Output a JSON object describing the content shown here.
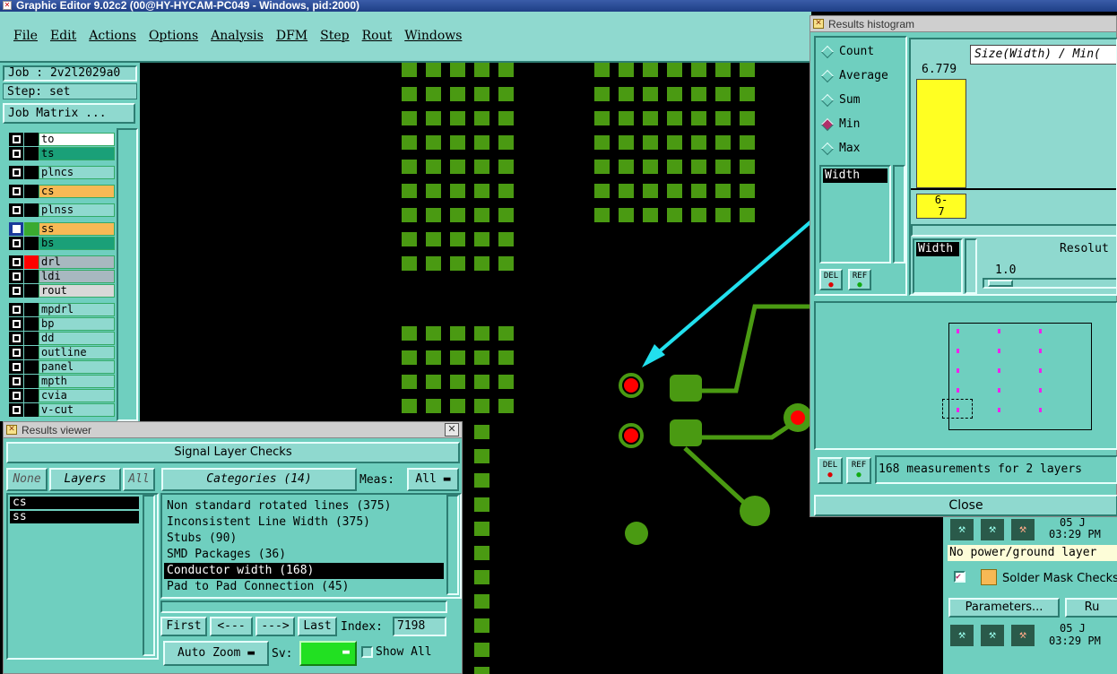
{
  "app": {
    "title": "Graphic Editor 9.02c2 (00@HY-HYCAM-PC049 - Windows, pid:2000)"
  },
  "menu": [
    "File",
    "Edit",
    "Actions",
    "Options",
    "Analysis",
    "DFM",
    "Step",
    "Rout",
    "Windows"
  ],
  "job": {
    "job_label": "Job : 2v2l2029a0",
    "step_label": "Step: set",
    "matrix_button": "Job Matrix ..."
  },
  "layers": [
    {
      "name": "to",
      "color": "#ffffff"
    },
    {
      "name": "ts",
      "color": "#1aa078"
    },
    {
      "name": "plncs",
      "color": "#8fd9cf"
    },
    {
      "name": "cs",
      "color": "#f7b955"
    },
    {
      "name": "plnss",
      "color": "#8fd9cf"
    },
    {
      "name": "ss",
      "color": "#f7b955"
    },
    {
      "name": "bs",
      "color": "#1aa078"
    },
    {
      "name": "drl",
      "color": "#a8b8c0"
    },
    {
      "name": "ldi",
      "color": "#a8b8c0"
    },
    {
      "name": "rout",
      "color": "#d8d8d8"
    },
    {
      "name": "mpdrl",
      "color": "#8fd9cf"
    },
    {
      "name": "bp",
      "color": "#8fd9cf"
    },
    {
      "name": "dd",
      "color": "#8fd9cf"
    },
    {
      "name": "outline",
      "color": "#8fd9cf"
    },
    {
      "name": "panel",
      "color": "#8fd9cf"
    },
    {
      "name": "mpth",
      "color": "#8fd9cf"
    },
    {
      "name": "cvia",
      "color": "#8fd9cf"
    },
    {
      "name": "v-cut",
      "color": "#8fd9cf"
    }
  ],
  "results_viewer": {
    "title": "Results viewer",
    "header": "Signal Layer Checks",
    "none_btn": "None",
    "layers_btn": "Layers",
    "all_btn": "All",
    "selected_layers": [
      "cs",
      "ss"
    ],
    "categories_btn": "Categories (14)",
    "meas_label": "Meas:",
    "meas_value": "All",
    "categories": [
      "Non standard rotated lines (375)",
      "Inconsistent Line Width (375)",
      "Stubs (90)",
      "SMD Packages (36)",
      "Conductor width (168)",
      "Pad to Pad Connection (45)"
    ],
    "selected_category": "Conductor width (168)",
    "first": "First",
    "prev": "<---",
    "next": "--->",
    "last": "Last",
    "index_label": "Index:",
    "index_value": "7198",
    "auto_zoom": "Auto Zoom",
    "sv_label": "Sv:",
    "show_all": "Show All"
  },
  "histogram": {
    "title": "Results histogram",
    "radios": [
      {
        "label": "Count",
        "on": false
      },
      {
        "label": "Average",
        "on": false
      },
      {
        "label": "Sum",
        "on": false
      },
      {
        "label": "Min",
        "on": true
      },
      {
        "label": "Max",
        "on": false
      }
    ],
    "attr_selected": "Width",
    "bar_value": "6.779",
    "bar_label": "6-\n7",
    "chart_title": "Size(Width) / Min(",
    "width_label": "Width",
    "resolution_label": "Resolut",
    "resolution_value": "1.0",
    "del": "DEL",
    "ref": "REF",
    "summary": "168 measurements for 2 layers",
    "close": "Close"
  },
  "side_panel": {
    "date1": "05 J",
    "time1": "03:29 PM",
    "note": "No power/ground layer",
    "solder_mask": "Solder Mask Checks",
    "parameters_btn": "Parameters...",
    "run_btn": "Ru",
    "date2": "05 J",
    "time2": "03:29 PM"
  },
  "colors": {
    "accent": "#8fd9cf",
    "pad": "#4a9a12",
    "arrow": "#22e0ee",
    "drill": "#ff0000",
    "bar": "#ffff22"
  }
}
